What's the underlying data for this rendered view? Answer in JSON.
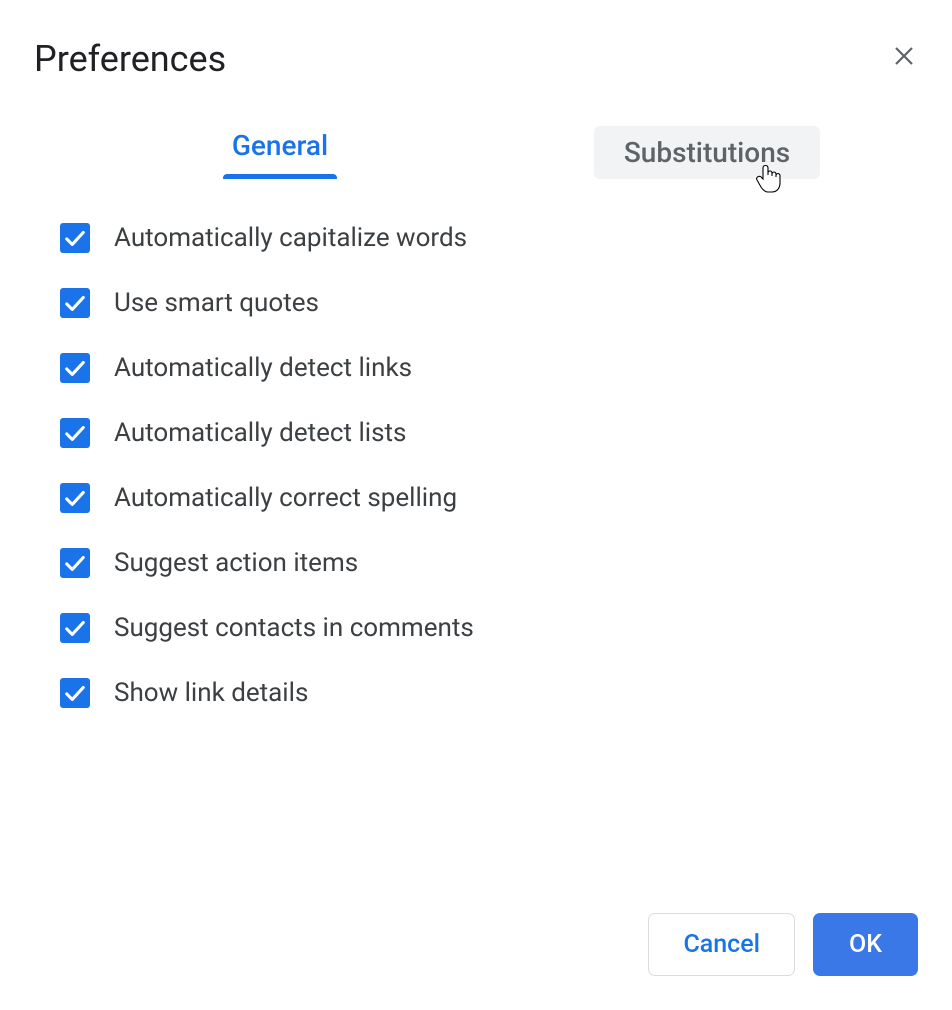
{
  "dialog": {
    "title": "Preferences"
  },
  "tabs": {
    "general": "General",
    "substitutions": "Substitutions"
  },
  "options": [
    {
      "label": "Automatically capitalize words",
      "checked": true
    },
    {
      "label": "Use smart quotes",
      "checked": true
    },
    {
      "label": "Automatically detect links",
      "checked": true
    },
    {
      "label": "Automatically detect lists",
      "checked": true
    },
    {
      "label": "Automatically correct spelling",
      "checked": true
    },
    {
      "label": "Suggest action items",
      "checked": true
    },
    {
      "label": "Suggest contacts in comments",
      "checked": true
    },
    {
      "label": "Show link details",
      "checked": true
    }
  ],
  "footer": {
    "cancel": "Cancel",
    "ok": "OK"
  }
}
